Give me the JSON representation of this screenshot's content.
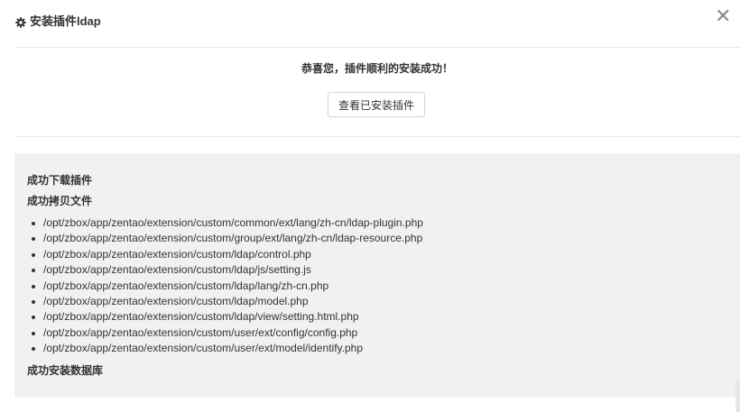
{
  "dialog": {
    "title": "安装插件ldap",
    "title_icon": "gear-icon",
    "close_symbol": "✕",
    "close_icon": "close-icon"
  },
  "result": {
    "success_message": "恭喜您，插件顺利的安装成功！",
    "view_button_label": "查看已安装插件"
  },
  "log": {
    "download_heading": "成功下载插件",
    "copy_heading": "成功拷贝文件",
    "files": [
      "/opt/zbox/app/zentao/extension/custom/common/ext/lang/zh-cn/ldap-plugin.php",
      "/opt/zbox/app/zentao/extension/custom/group/ext/lang/zh-cn/ldap-resource.php",
      "/opt/zbox/app/zentao/extension/custom/ldap/control.php",
      "/opt/zbox/app/zentao/extension/custom/ldap/js/setting.js",
      "/opt/zbox/app/zentao/extension/custom/ldap/lang/zh-cn.php",
      "/opt/zbox/app/zentao/extension/custom/ldap/model.php",
      "/opt/zbox/app/zentao/extension/custom/ldap/view/setting.html.php",
      "/opt/zbox/app/zentao/extension/custom/user/ext/config/config.php",
      "/opt/zbox/app/zentao/extension/custom/user/ext/model/identify.php"
    ],
    "db_heading": "成功安装数据库"
  },
  "colors": {
    "panel_background": "#f1f1f1",
    "divider": "#e9e9e9",
    "text": "#333333",
    "close_icon": "#8a8a8a"
  }
}
